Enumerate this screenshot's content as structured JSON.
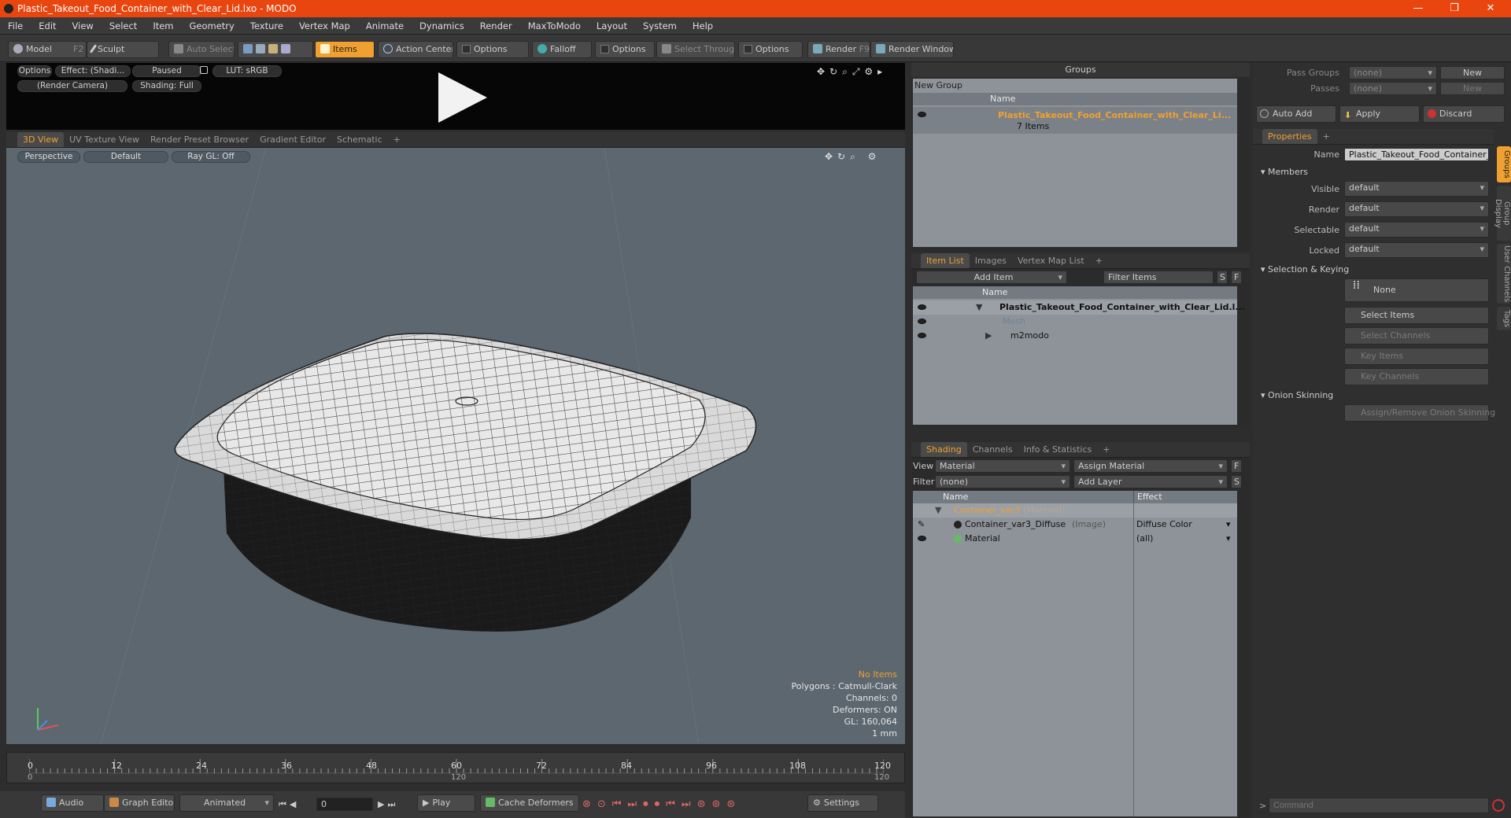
{
  "window": {
    "title": "Plastic_Takeout_Food_Container_with_Clear_Lid.lxo - MODO",
    "minimize": "—",
    "restore": "❐",
    "close": "✕"
  },
  "menu": [
    "File",
    "Edit",
    "View",
    "Select",
    "Item",
    "Geometry",
    "Texture",
    "Vertex Map",
    "Animate",
    "Dynamics",
    "Render",
    "MaxToModo",
    "Layout",
    "System",
    "Help"
  ],
  "toolbar": {
    "model": "Model",
    "model_key": "F2",
    "sculpt": "Sculpt",
    "auto_select": "Auto Select",
    "items": "Items",
    "action_center": "Action Center",
    "options1": "Options",
    "falloff": "Falloff",
    "options2": "Options",
    "select_through": "Select Through",
    "options3": "Options",
    "render": "Render",
    "render_key": "F9",
    "render_window": "Render Window"
  },
  "preview": {
    "options": "Options",
    "effect": "Effect: (Shadi...",
    "paused": "Paused",
    "lut": "LUT: sRGB",
    "camera": "(Render Camera)",
    "shading": "Shading: Full"
  },
  "viewtabs": [
    "3D View",
    "UV Texture View",
    "Render Preset Browser",
    "Gradient Editor",
    "Schematic",
    "+"
  ],
  "viewport": {
    "perspective": "Perspective",
    "default": "Default",
    "raygl": "Ray GL: Off"
  },
  "stats": {
    "no_items": "No Items",
    "polygons": "Polygons : Catmull-Clark",
    "channels": "Channels: 0",
    "deformers": "Deformers: ON",
    "gl": "GL: 160,064",
    "unit": "1 mm"
  },
  "timeline": {
    "ticks": [
      "0",
      "12",
      "24",
      "36",
      "48",
      "60",
      "72",
      "84",
      "96",
      "108",
      "120"
    ],
    "start": "0",
    "end": "120",
    "mid": "120",
    "end2": "120"
  },
  "bottombar": {
    "audio": "Audio",
    "graph_editor": "Graph Editor",
    "animated": "Animated",
    "frame": "0",
    "play": "Play",
    "cache_deformers": "Cache Deformers",
    "settings": "Settings"
  },
  "groups": {
    "title": "Groups",
    "new_group": "New Group",
    "col_name": "Name",
    "item_name": "Plastic_Takeout_Food_Container_with_Clear_Li...",
    "item_count": "7 Items"
  },
  "itemlist": {
    "tabs": [
      "Item List",
      "Images",
      "Vertex Map List",
      "+"
    ],
    "add_item": "Add Item",
    "filter": "Filter Items",
    "s": "S",
    "f": "F",
    "col_name": "Name",
    "rows": [
      {
        "name": "Plastic_Takeout_Food_Container_with_Clear_Lid.l..."
      },
      {
        "name": "Mesh"
      },
      {
        "name": "m2modo"
      }
    ]
  },
  "shading": {
    "tabs": [
      "Shading",
      "Channels",
      "Info & Statistics",
      "+"
    ],
    "view_label": "View",
    "view_value": "Material",
    "assign_material": "Assign Material",
    "f": "F",
    "filter_label": "Filter",
    "filter_value": "(none)",
    "add_layer": "Add Layer",
    "s": "S",
    "col_name": "Name",
    "col_effect": "Effect",
    "rows": [
      {
        "name": "Container_var3",
        "type": "(Material)",
        "effect": ""
      },
      {
        "name": "Container_var3_Diffuse",
        "type": "(Image)",
        "effect": "Diffuse Color"
      },
      {
        "name": "Material",
        "type": "",
        "effect": "(all)"
      }
    ]
  },
  "props": {
    "pass_groups_label": "Pass Groups",
    "pass_groups_value": "(none)",
    "new": "New",
    "passes_label": "Passes",
    "passes_value": "(none)",
    "new2": "New",
    "auto_add": "Auto Add",
    "apply": "Apply",
    "discard": "Discard",
    "tab": "Properties",
    "plus": "+",
    "name_label": "Name",
    "name_value": "Plastic_Takeout_Food_Container_wi",
    "members": "Members",
    "visible_label": "Visible",
    "visible_value": "default",
    "render_label": "Render",
    "render_value": "default",
    "selectable_label": "Selectable",
    "selectable_value": "default",
    "locked_label": "Locked",
    "locked_value": "default",
    "sel_keying": "Selection & Keying",
    "none": "None",
    "select_items": "Select Items",
    "select_channels": "Select Channels",
    "key_items": "Key Items",
    "key_channels": "Key Channels",
    "onion": "Onion Skinning",
    "assign_onion": "Assign/Remove Onion Skinning",
    "vtabs": [
      "Groups",
      "Group Display",
      "User Channels",
      "Tags"
    ],
    "command_placeholder": "Command"
  }
}
